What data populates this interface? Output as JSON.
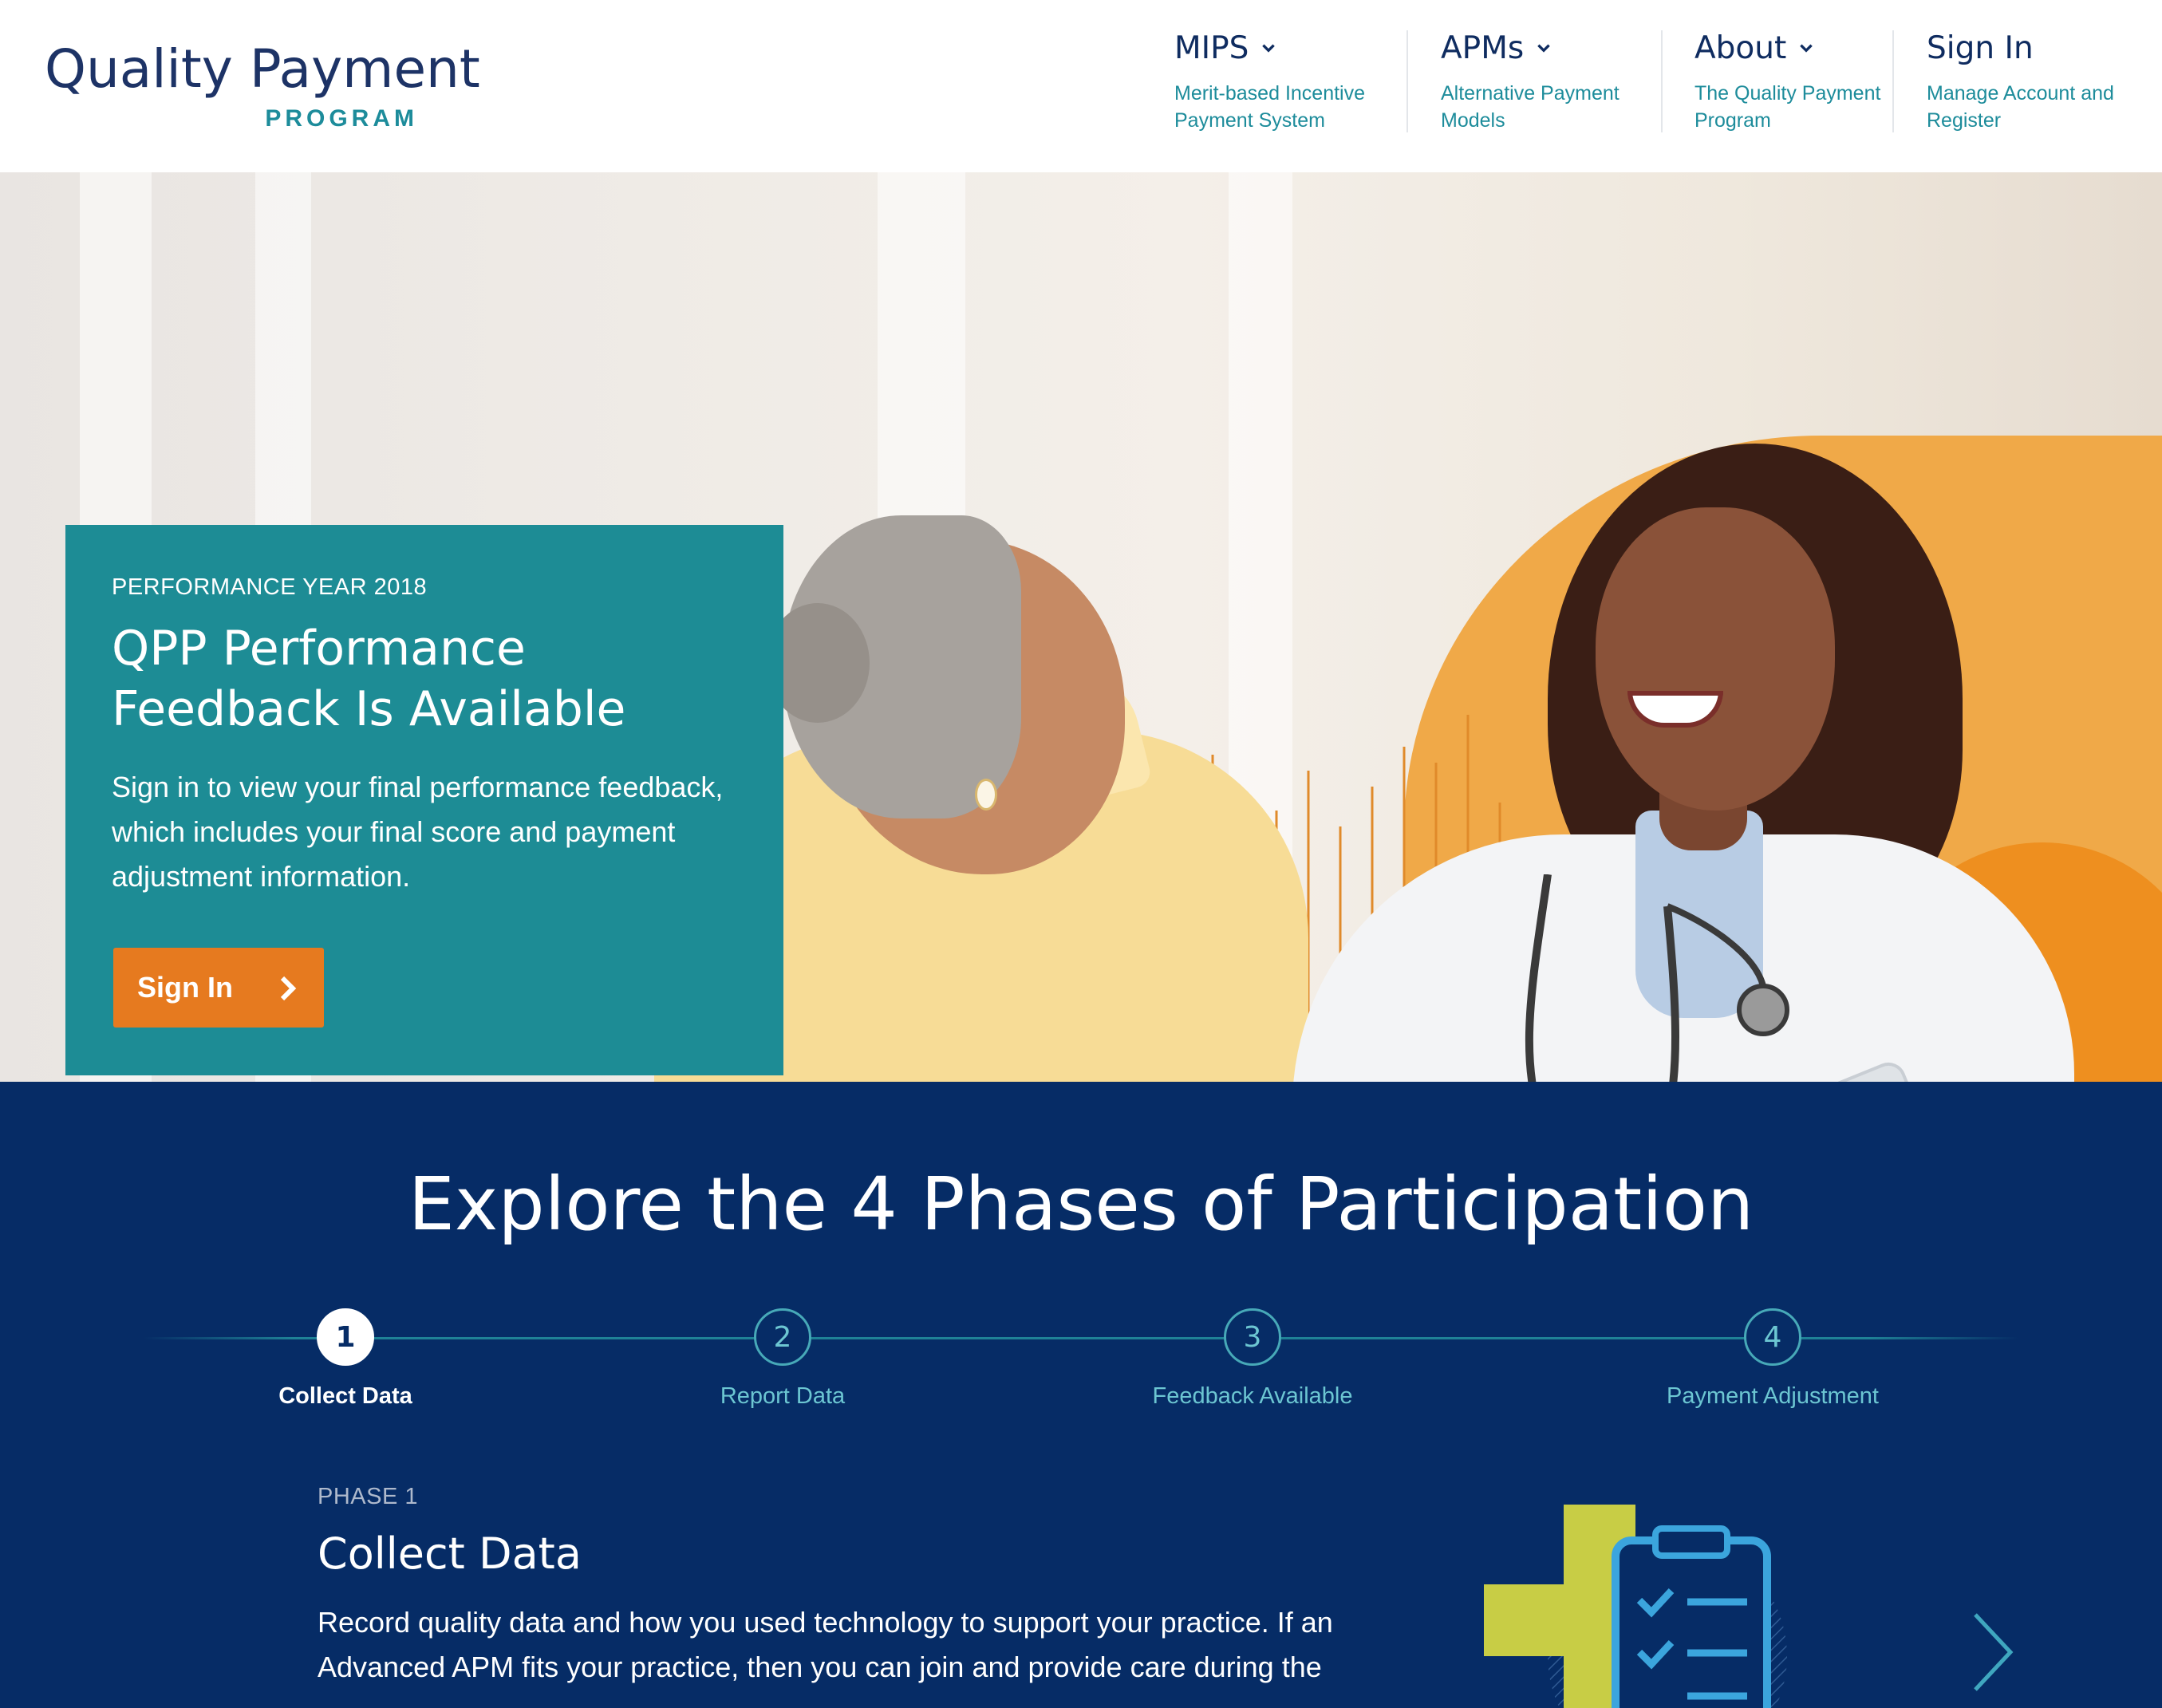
{
  "logo": {
    "line1": "Quality Payment",
    "line2": "PROGRAM"
  },
  "nav": [
    {
      "title": "MIPS",
      "subtitle": "Merit-based Incentive Payment System",
      "has_dropdown": true
    },
    {
      "title": "APMs",
      "subtitle": "Alternative Payment Models",
      "has_dropdown": true
    },
    {
      "title": "About",
      "subtitle": "The Quality Payment Program",
      "has_dropdown": true
    },
    {
      "title": "Sign In",
      "subtitle": "Manage Account and Register",
      "has_dropdown": false
    }
  ],
  "hero": {
    "eyebrow": "PERFORMANCE YEAR 2018",
    "title": "QPP Performance Feedback Is Available",
    "description": "Sign in to view your final performance feedback, which includes your final score and payment adjustment information.",
    "button_label": "Sign In"
  },
  "phases": {
    "title": "Explore the 4 Phases of Participation",
    "steps": [
      {
        "number": "1",
        "label": "Collect Data",
        "active": true
      },
      {
        "number": "2",
        "label": "Report Data",
        "active": false
      },
      {
        "number": "3",
        "label": "Feedback Available",
        "active": false
      },
      {
        "number": "4",
        "label": "Payment Adjustment",
        "active": false
      }
    ],
    "current": {
      "eyebrow": "PHASE 1",
      "heading": "Collect Data",
      "description": "Record quality data and how you used technology to support your practice. If an Advanced APM fits your practice, then you can join and provide care during the"
    }
  },
  "colors": {
    "navy": "#062c66",
    "teal": "#1d8c95",
    "orange": "#e67a1f",
    "link_teal": "#1d8c9b"
  },
  "icons": [
    "chevron-down-icon",
    "chevron-right-icon",
    "clipboard-plus-icon",
    "arrow-right-icon"
  ]
}
